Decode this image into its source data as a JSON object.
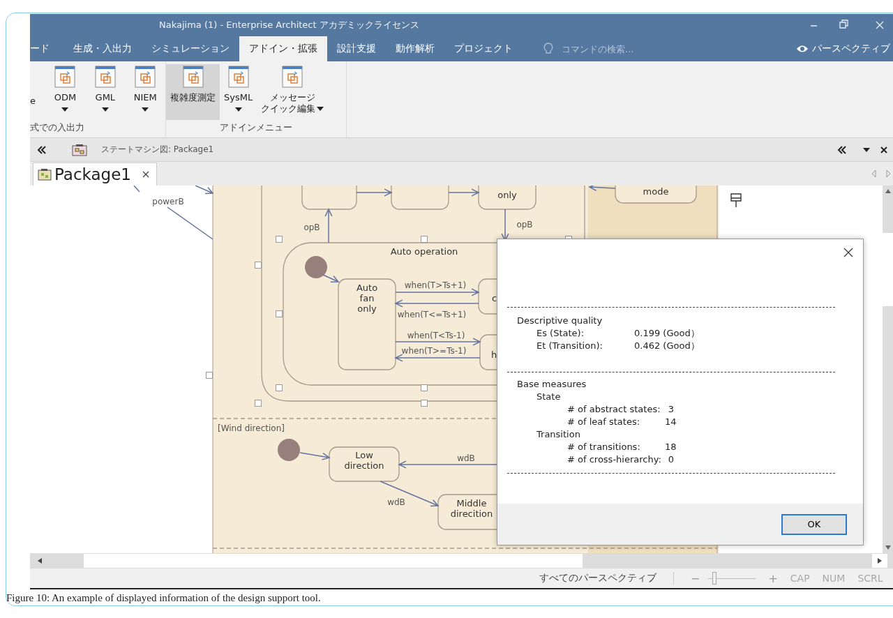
{
  "window": {
    "title": "Nakajima (1) - Enterprise Architect アカデミックライセンス"
  },
  "ribbon_tabs": [
    {
      "label": "ード",
      "selected": false
    },
    {
      "label": "生成・入出力",
      "selected": false
    },
    {
      "label": "シミュレーション",
      "selected": false
    },
    {
      "label": "アドイン・拡張",
      "selected": true
    },
    {
      "label": "設計支援",
      "selected": false
    },
    {
      "label": "動作解析",
      "selected": false
    },
    {
      "label": "プロジェクト",
      "selected": false
    }
  ],
  "command_search": {
    "placeholder": "コマンドの検索..."
  },
  "perspective_button": {
    "label": "パースペクティブ"
  },
  "ribbon_groups": [
    {
      "label": "式での入出力",
      "leading_text": "e",
      "buttons": [
        {
          "lines": [
            "ODM"
          ],
          "kind": "split",
          "selected": false
        },
        {
          "lines": [
            "GML"
          ],
          "kind": "split",
          "selected": false
        },
        {
          "lines": [
            "NIEM"
          ],
          "kind": "split",
          "selected": false
        }
      ]
    },
    {
      "label": "アドインメニュー",
      "buttons": [
        {
          "lines": [
            "複雑度測定"
          ],
          "kind": "plain",
          "selected": true
        },
        {
          "lines": [
            "SysML"
          ],
          "kind": "split",
          "selected": false
        },
        {
          "lines": [
            "メッセージ",
            "クイック編集"
          ],
          "kind": "menu",
          "selected": false
        }
      ]
    }
  ],
  "view_bar": {
    "title": "ステートマシン図: Package1"
  },
  "document_tabs": [
    {
      "label": "Package1",
      "selected": true
    }
  ],
  "diagram": {
    "composite_title": "Auto operation",
    "region_title": "[Wind direction]",
    "states": [
      {
        "lines": [
          "only"
        ]
      },
      {
        "lines": [
          "mode"
        ]
      },
      {
        "lines": [
          "Auto",
          "fan",
          "only"
        ]
      },
      {
        "lines": [
          "c"
        ]
      },
      {
        "lines": [
          "h"
        ]
      },
      {
        "lines": [
          "Low",
          "direction"
        ]
      },
      {
        "lines": [
          "Middle",
          "direcition"
        ]
      }
    ],
    "transition_labels": [
      "powerB",
      "opB",
      "opB",
      "when(T>Ts+1)",
      "when(T<=Ts+1)",
      "when(T<Ts-1)",
      "when(T>=Ts-1)",
      "wdB",
      "wdB"
    ]
  },
  "dialog": {
    "sections": [
      {
        "title": "Descriptive quality",
        "rows": [
          {
            "label": "Es (State):",
            "value": "0.199 (Good）"
          },
          {
            "label": "Et (Transition):",
            "value": "0.462 (Good）"
          }
        ]
      },
      {
        "title": "Base measures",
        "groups": [
          {
            "title": "State",
            "rows": [
              {
                "label": "# of abstract states:",
                "value": "3"
              },
              {
                "label": "# of leaf states:",
                "value": "14"
              }
            ]
          },
          {
            "title": "Transition",
            "rows": [
              {
                "label": "# of transitions:",
                "value": "18"
              },
              {
                "label": "# of cross-hierarchy:",
                "value": "0"
              }
            ]
          }
        ]
      }
    ],
    "ok_button": "OK"
  },
  "status_bar": {
    "perspective": "すべてのパースペクティブ",
    "zoom": {
      "minus": "−",
      "plus": "+",
      "level": 0.08
    },
    "indicators": [
      {
        "label": "CAP",
        "on": false
      },
      {
        "label": "NUM",
        "on": false
      },
      {
        "label": "SCRL",
        "on": false
      }
    ]
  },
  "caption": "Figure 10: An example of displayed information of the design support tool."
}
